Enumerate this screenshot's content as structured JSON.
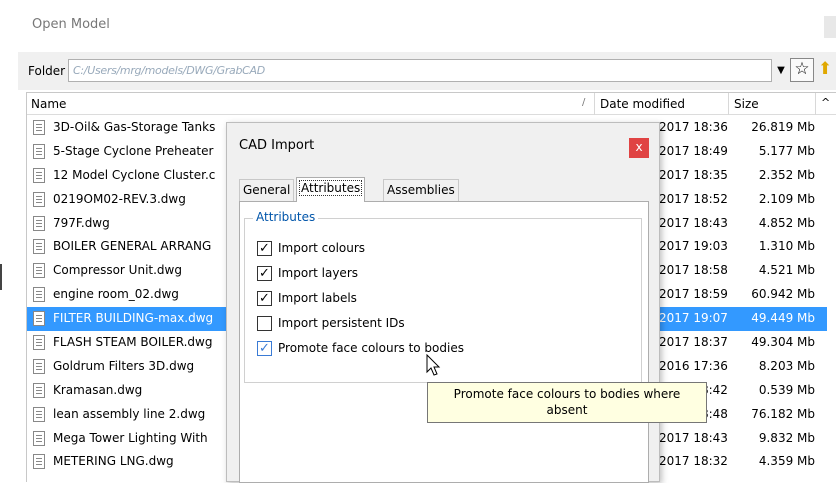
{
  "window": {
    "title": "Open Model"
  },
  "folder": {
    "label": "Folder",
    "path": "C:/Users/mrg/models/DWG/GrabCAD"
  },
  "columns": {
    "name": "Name",
    "sort_indicator": "/",
    "date": "Date modified",
    "size": "Size",
    "scroll_arrow": "^"
  },
  "files": [
    {
      "name": "3D-Oil& Gas-Storage Tanks",
      "date": "2017 18:36",
      "size": "26.819 Mb",
      "selected": false
    },
    {
      "name": "5-Stage Cyclone Preheater",
      "date": "2017 18:49",
      "size": "5.177 Mb",
      "selected": false
    },
    {
      "name": "12 Model Cyclone Cluster.c",
      "date": "2017 18:35",
      "size": "2.352 Mb",
      "selected": false
    },
    {
      "name": "0219OM02-REV.3.dwg",
      "date": "2017 18:52",
      "size": "2.109 Mb",
      "selected": false
    },
    {
      "name": "797F.dwg",
      "date": "2017 18:43",
      "size": "4.852 Mb",
      "selected": false
    },
    {
      "name": "BOILER GENERAL ARRANG",
      "date": "2017 19:03",
      "size": "1.310 Mb",
      "selected": false
    },
    {
      "name": "Compressor Unit.dwg",
      "date": "2017 18:58",
      "size": "4.521 Mb",
      "selected": false
    },
    {
      "name": "engine room_02.dwg",
      "date": "2017 18:59",
      "size": "60.942 Mb",
      "selected": false
    },
    {
      "name": "FILTER BUILDING-max.dwg",
      "date": "2017 19:07",
      "size": "49.449 Mb",
      "selected": true
    },
    {
      "name": "FLASH STEAM BOILER.dwg",
      "date": "2017 18:37",
      "size": "49.304 Mb",
      "selected": false
    },
    {
      "name": "Goldrum Filters 3D.dwg",
      "date": "2016 17:36",
      "size": "8.203 Mb",
      "selected": false
    },
    {
      "name": "Kramasan.dwg",
      "date": "2017 18:42",
      "size": "0.539 Mb",
      "selected": false
    },
    {
      "name": "lean assembly line 2.dwg",
      "date": "2017 18:48",
      "size": "76.182 Mb",
      "selected": false
    },
    {
      "name": "Mega Tower Lighting With",
      "date": "2017 18:43",
      "size": "9.832 Mb",
      "selected": false
    },
    {
      "name": "METERING LNG.dwg",
      "date": "2017 18:32",
      "size": "4.359 Mb",
      "selected": false
    }
  ],
  "dialog": {
    "title": "CAD Import",
    "close_glyph": "x",
    "tabs": [
      "General",
      "Attributes",
      "Assemblies"
    ],
    "active_tab": "Attributes",
    "group_label": "Attributes",
    "options": [
      {
        "label": "Import colours",
        "checked": true
      },
      {
        "label": "Import layers",
        "checked": true
      },
      {
        "label": "Import labels",
        "checked": true
      },
      {
        "label": "Import persistent IDs",
        "checked": false
      },
      {
        "label": "Promote face colours to bodies",
        "checked": true
      }
    ]
  },
  "tooltip": {
    "line1": "Promote face colours to bodies where",
    "line2": "absent"
  },
  "icons": {
    "favorite": "star-icon",
    "up_folder": "folder-up-icon",
    "file": "document-icon",
    "dropdown": "chevron-down-icon"
  },
  "colors": {
    "selection": "#3399ff",
    "close_button": "#e04343",
    "group_label": "#0055aa",
    "tooltip_bg": "#ffffe1"
  }
}
